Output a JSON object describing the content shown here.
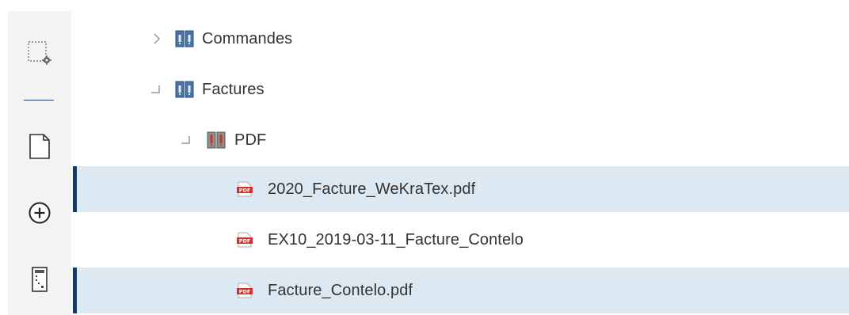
{
  "toolbar": {
    "tools": [
      {
        "name": "select-settings-icon"
      },
      {
        "name": "document-icon"
      },
      {
        "name": "add-circle-icon"
      },
      {
        "name": "form-icon"
      }
    ]
  },
  "tree": {
    "nodes": [
      {
        "label": "Commandes",
        "type": "folder",
        "state": "collapsed"
      },
      {
        "label": "Factures",
        "type": "folder",
        "state": "expanded"
      },
      {
        "label": "PDF",
        "type": "folder-red",
        "state": "expanded"
      },
      {
        "label": "2020_Facture_WeKraTex.pdf",
        "type": "pdf",
        "selected": true
      },
      {
        "label": "EX10_2019-03-11_Facture_Contelo",
        "type": "pdf",
        "selected": false
      },
      {
        "label": "Facture_Contelo.pdf",
        "type": "pdf",
        "selected": true
      }
    ]
  },
  "colors": {
    "selection_bg": "#dde9f2",
    "selection_bar": "#163a63",
    "folder_blue": "#4a73a8",
    "folder_red": "#c0392b",
    "pdf_red": "#d32f2f"
  }
}
